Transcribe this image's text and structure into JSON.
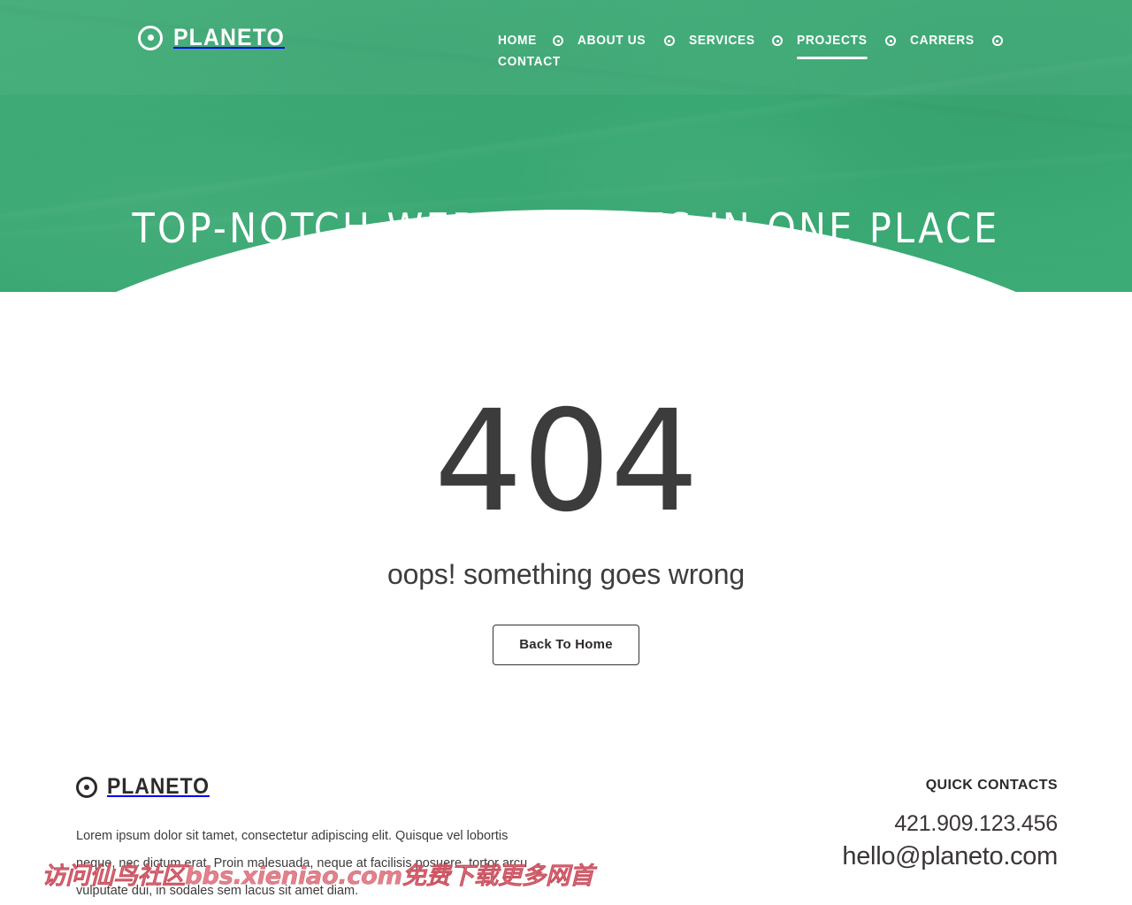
{
  "brand": {
    "name": "PLANETO",
    "logo_icon": "circle-dot-icon"
  },
  "nav": {
    "separator_icon": "circle-dot-icon",
    "items": [
      {
        "label": "HOME",
        "active": false
      },
      {
        "label": "ABOUT US",
        "active": false
      },
      {
        "label": "SERVICES",
        "active": false
      },
      {
        "label": "PROJECTS",
        "active": true
      },
      {
        "label": "CARRERS",
        "active": false
      },
      {
        "label": "CONTACT",
        "active": false
      }
    ]
  },
  "hero": {
    "title": "TOP-NOTCH WEB SERVICES IN ONE PLACE",
    "overlay_color": "#3cab76"
  },
  "error": {
    "code": "404",
    "message": "oops! something goes wrong",
    "button_label": "Back To Home"
  },
  "footer": {
    "brand": "PLANETO",
    "logo_icon": "circle-dot-icon",
    "description": "Lorem ipsum dolor sit tamet, consectetur adipiscing elit. Quisque vel lobortis neque, nec dictum erat. Proin malesuada, neque at facilisis posuere, tortor arcu vulputate dui, in sodales sem lacus sit amet diam.",
    "contacts": {
      "title": "QUICK CONTACTS",
      "phone": "421.909.123.456",
      "email": "hello@planeto.com"
    }
  },
  "watermark": {
    "text": "访问仙鸟社区bbs.xieniao.com免费下载更多网首",
    "color": "#e07682"
  }
}
